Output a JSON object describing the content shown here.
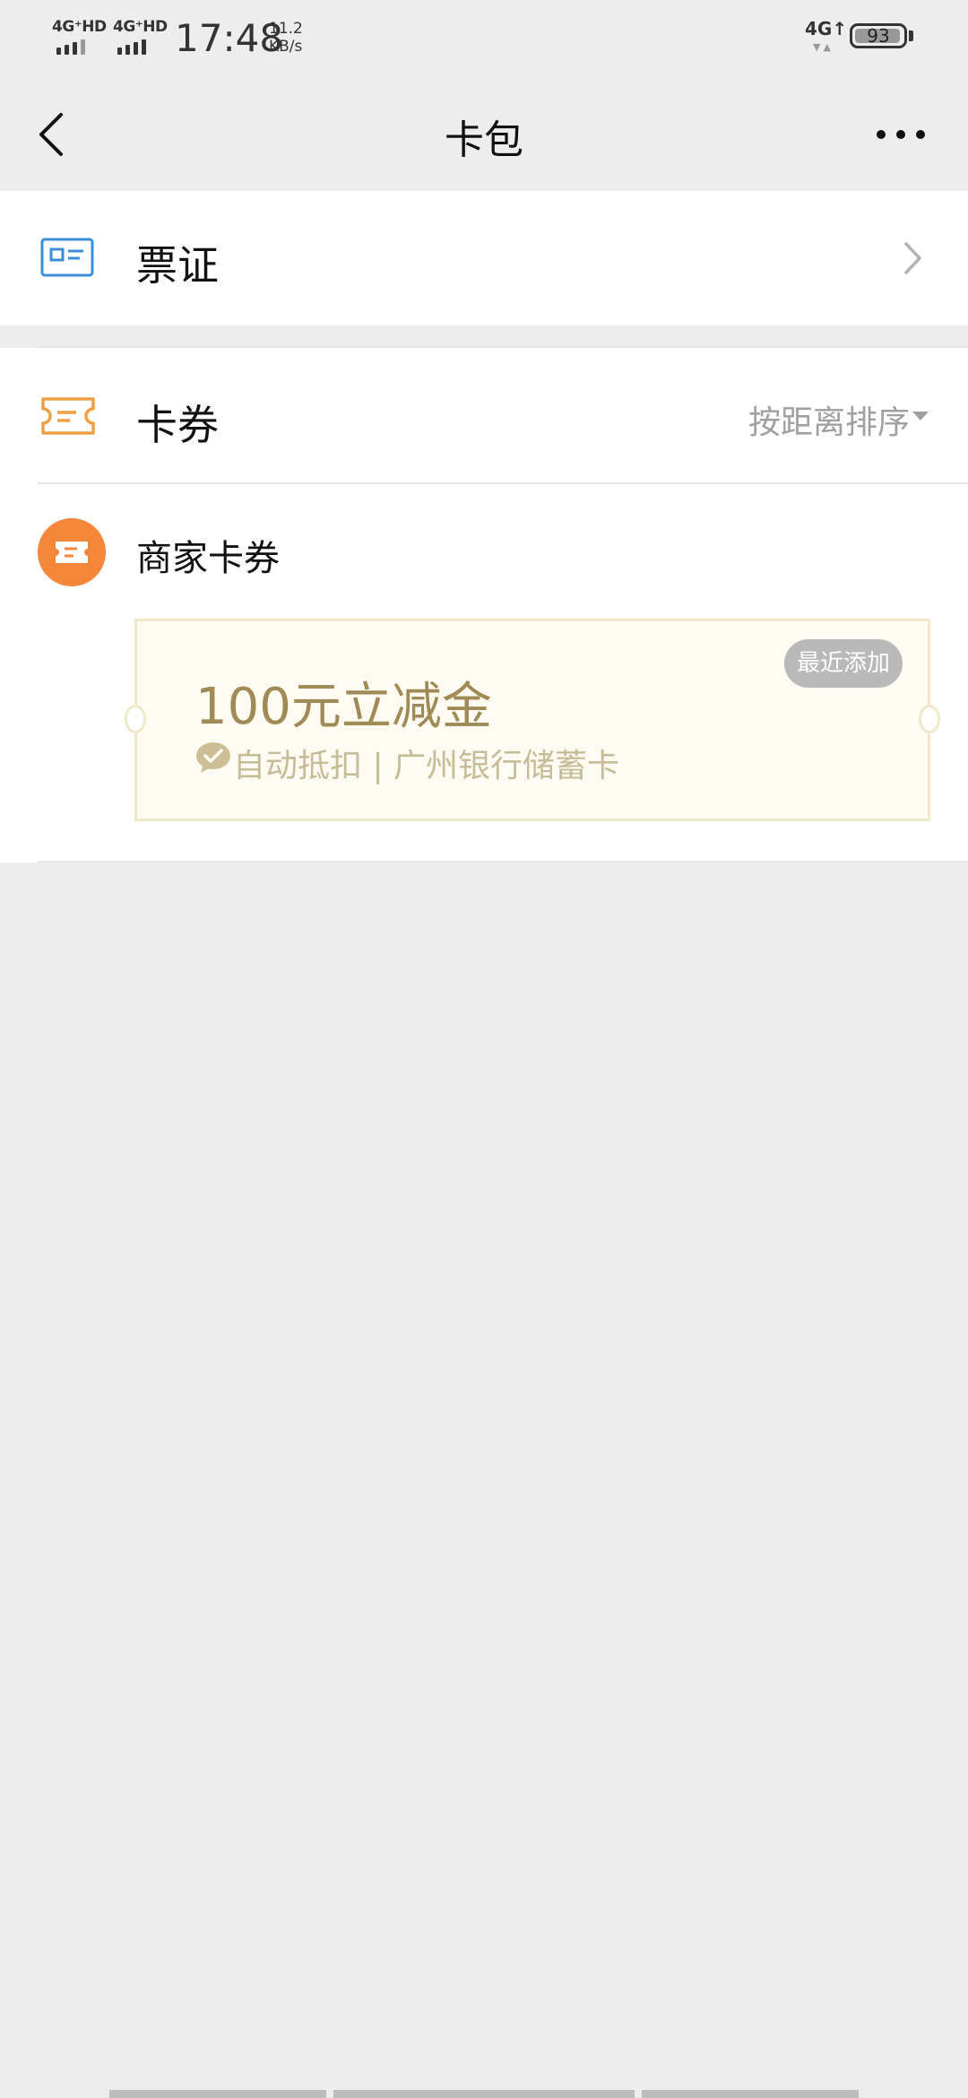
{
  "status_bar": {
    "sim1_label": "4G⁺HD",
    "sim2_label": "4G⁺HD",
    "time": "17:48",
    "speed_value": "11.2",
    "speed_unit": "KB/s",
    "network_right": "4G↑",
    "battery": "93"
  },
  "nav": {
    "title": "卡包",
    "back_icon": "back-arrow-icon",
    "more_icon": "more-dots-icon"
  },
  "tickets_row": {
    "label": "票证",
    "icon": "id-card-icon",
    "accent": "#3c8fd6"
  },
  "coupons_row": {
    "label": "卡券",
    "sort_label": "按距离排序",
    "icon": "ticket-icon",
    "accent": "#f0a044"
  },
  "merchant": {
    "label": "商家卡券",
    "icon_color": "#f48739"
  },
  "coupon_card": {
    "title": "100元立减金",
    "subtitle": "自动抵扣 | 广州银行储蓄卡",
    "badge": "最近添加",
    "title_color": "#a08a56"
  }
}
